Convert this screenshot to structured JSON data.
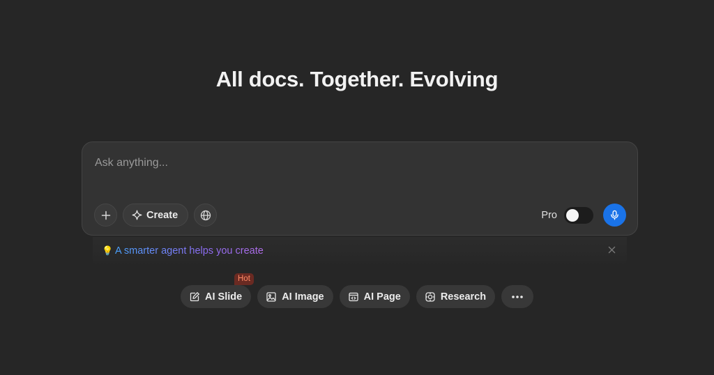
{
  "headline": "All docs. Together. Evolving",
  "composer": {
    "placeholder": "Ask anything...",
    "create_label": "Create",
    "pro_label": "Pro",
    "pro_enabled": false,
    "icons": {
      "add": "plus-icon",
      "create": "sparkle-icon",
      "web": "globe-icon",
      "mic": "microphone-icon"
    }
  },
  "hint": {
    "text": "A smarter agent helps you create",
    "icon": "lightbulb-icon"
  },
  "quick_actions": [
    {
      "label": "AI Slide",
      "icon": "slide-edit-icon",
      "badge": "Hot"
    },
    {
      "label": "AI Image",
      "icon": "image-icon"
    },
    {
      "label": "AI Page",
      "icon": "page-icon"
    },
    {
      "label": "Research",
      "icon": "research-icon"
    }
  ],
  "colors": {
    "background": "#262626",
    "composer": "#333333",
    "accent_blue": "#1a73e8",
    "hot_badge": "#6a2a22"
  }
}
